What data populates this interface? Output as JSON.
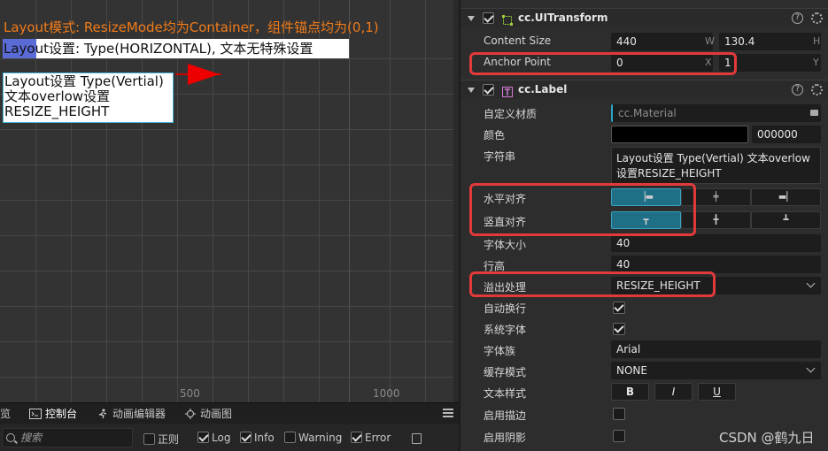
{
  "scene": {
    "title": "Layout模式: ResizeMode均为Container，组件锚点均为(0,1)",
    "box1_text": "Layout设置: Type(HORIZONTAL), 文本无特殊设置",
    "box2_lines": [
      "Layout设置 Type(Vertial)",
      "文本overlow设置",
      "RESIZE_HEIGHT"
    ],
    "ruler_labels": [
      "500",
      "1000"
    ]
  },
  "bottom_panel": {
    "tabs": [
      {
        "label": "览",
        "icon": "preview-icon"
      },
      {
        "label": "控制台",
        "icon": "console-icon"
      },
      {
        "label": "动画编辑器",
        "icon": "running-man-icon"
      },
      {
        "label": "动画图",
        "icon": "animation-graph-icon"
      }
    ],
    "search_placeholder": "搜索",
    "filters": [
      {
        "label": "正则",
        "checked": false
      },
      {
        "label": "Log",
        "checked": true
      },
      {
        "label": "Info",
        "checked": true
      },
      {
        "label": "Warning",
        "checked": false
      },
      {
        "label": "Error",
        "checked": true
      }
    ]
  },
  "inspector": {
    "uitransform": {
      "title": "cc.UITransform",
      "content_size_label": "Content Size",
      "content_w": "440",
      "content_h": "130.4",
      "w_axis": "W",
      "h_axis": "H",
      "anchor_label": "Anchor Point",
      "anchor_x": "0",
      "anchor_y": "1",
      "x_axis": "X",
      "y_axis": "Y"
    },
    "label": {
      "title": "cc.Label",
      "material_label": "自定义材质",
      "material_value": "cc.Material",
      "color_label": "颜色",
      "color_hex": "000000",
      "color_value": "#000000",
      "string_label": "字符串",
      "string_value": "Layout设置 Type(Vertial) 文本overlow设置RESIZE_HEIGHT",
      "h_align_label": "水平对齐",
      "v_align_label": "竖直对齐",
      "font_size_label": "字体大小",
      "font_size": "40",
      "line_height_label": "行高",
      "line_height": "40",
      "overflow_label": "溢出处理",
      "overflow_value": "RESIZE_HEIGHT",
      "wrap_label": "自动换行",
      "wrap": true,
      "system_font_label": "系统字体",
      "system_font": true,
      "font_family_label": "字体族",
      "font_family": "Arial",
      "cache_label": "缓存模式",
      "cache_value": "NONE",
      "style_label": "文本样式",
      "bold": "B",
      "italic": "I",
      "underline": "U",
      "outline_label": "启用描边",
      "outline": false,
      "shadow_label": "启用阴影",
      "shadow": false
    }
  },
  "watermark": "CSDN @鹤九日",
  "colors": {
    "highlight": "#e23a3a",
    "scene_title": "#f07b19",
    "active_button": "#1f6f86"
  }
}
